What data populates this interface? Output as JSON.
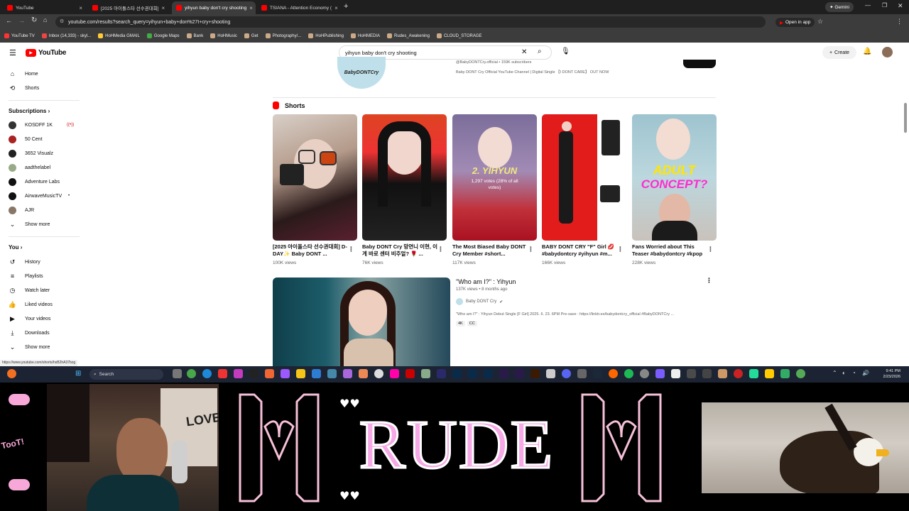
{
  "browser": {
    "tabs": [
      {
        "label": "YouTube",
        "color": "#ff0000"
      },
      {
        "label": "[2025 아이돌스타 선수권대회]",
        "color": "#ff0000"
      },
      {
        "label": "yihyun baby don't cry shooting",
        "color": "#ff0000"
      },
      {
        "label": "TSIANA - Attention Economy (",
        "color": "#ff0000"
      }
    ],
    "gemini_label": "Gemini",
    "url": "youtube.com/results?search_query=yihyun+baby+don%27t+cry+shooting",
    "open_in_app": "Open in app",
    "bookmarks": [
      "YouTube TV",
      "Inbox (14,333) - skyl...",
      "HoHMedia GMAIL",
      "Google Maps",
      "Bank",
      "HoHMusic",
      "Get",
      "Photography/...",
      "HoHPublishing",
      "HoHMEDIA",
      "Rudes_Awakening",
      "CLOUD_STORAGE"
    ],
    "status_url": "https://www.youtube.com/shorts/hxB2hA37bzg"
  },
  "youtube": {
    "logo": "YouTube",
    "search_value": "yihyun baby don't cry shooting",
    "create_label": "Create",
    "channel_info": "@BabyDONTCry.official • 159K subscribers",
    "channel_desc": "Baby DONT Cry Official YouTube Channel | Digital Single 【I DONT CARE】 OUT NOW",
    "channel_logo_text": "BabyDONTCry",
    "sidebar": {
      "home": "Home",
      "shorts": "Shorts",
      "subscriptions": "Subscriptions",
      "subs": [
        "KOSDFF 1K",
        "50 Cent",
        "3652 Visualz",
        "aadthelabel",
        "Adventure Labs",
        "AirwaveMusicTV",
        "AJR"
      ],
      "show_more": "Show more",
      "you": "You",
      "you_items": [
        "History",
        "Playlists",
        "Watch later",
        "Liked videos",
        "Your videos",
        "Downloads"
      ],
      "show_more2": "Show more"
    },
    "shorts_heading": "Shorts",
    "shorts": [
      {
        "title": "[2025 아이돌스타 선수권대회] D-DAY✨ Baby DONT ...",
        "views": "100K views"
      },
      {
        "title": "Baby DONT Cry 망연니 이현, 이게 바로 센터 비주얼? 🌹 ...",
        "views": "76K views"
      },
      {
        "title": "The Most Biased Baby DONT Cry Member #short...",
        "views": "117K views"
      },
      {
        "title": "BABY DONT CRY \"F\" Girl 💋 #babydontcry #yihyun #m...",
        "views": "166K views"
      },
      {
        "title": "Fans Worried about This Teaser #babydontcry #kpop",
        "views": "228K views"
      }
    ],
    "short_overlays": {
      "s3": "2. YIHYUN",
      "s3b": "1,297 votes (28% of all votes)",
      "s5a": "ADULT",
      "s5b": "CONCEPT?"
    },
    "video": {
      "title": "\"Who am I?\" : Yihyun",
      "meta": "137K views • 8 months ago",
      "channel": "Baby DONT Cry",
      "desc": "\"Who am I?\" : Yihyun Debut Single [F Girl] 2025. 6. 23. 6PM Pre-save : https://linktr.ee/babydontcry_official #BabyDONTCry ...",
      "badges": [
        "4K",
        "CC"
      ]
    }
  },
  "taskbar": {
    "search": "Search",
    "time": "9:41 PM",
    "date": "2/23/2026"
  },
  "stream": {
    "banner": "RUDE",
    "toot": "TooT!",
    "love": "LOVE"
  },
  "colors": {
    "yt_red": "#ff0000",
    "pink": "#f6a9e6",
    "taskbar": "#1c2434"
  }
}
